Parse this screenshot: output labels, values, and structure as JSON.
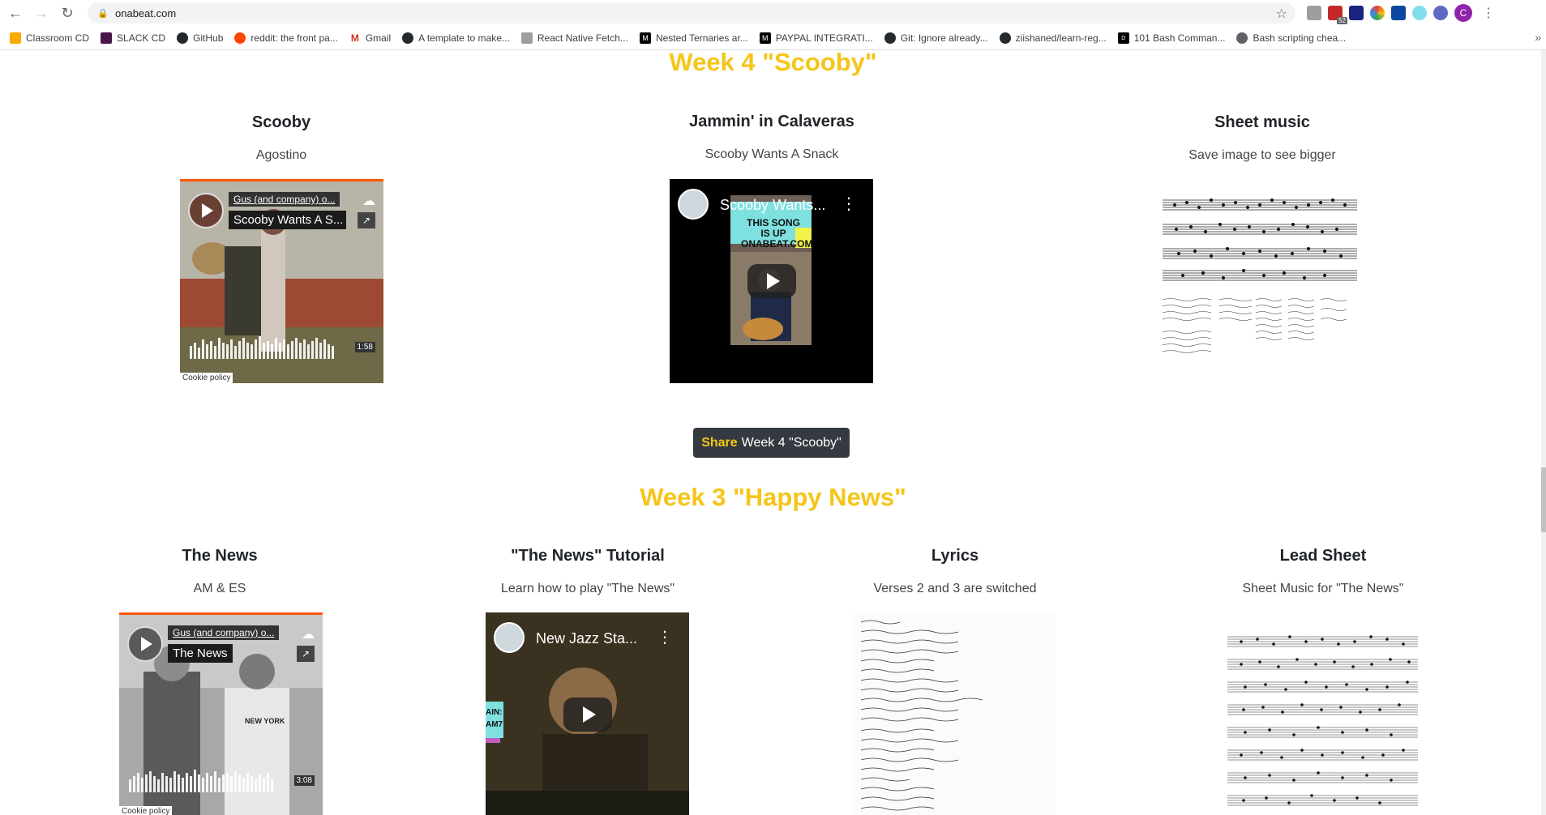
{
  "browser": {
    "url": "onabeat.com",
    "extension_badge": "52",
    "profile_initial": "C",
    "bookmarks": [
      {
        "label": "Classroom CD",
        "color": "#f9ab00"
      },
      {
        "label": "SLACK CD",
        "color": "#4a154b"
      },
      {
        "label": "GitHub",
        "color": "#24292e"
      },
      {
        "label": "reddit: the front pa...",
        "color": "#ff4500"
      },
      {
        "label": "Gmail",
        "color": "#d93025"
      },
      {
        "label": "A template to make...",
        "color": "#24292e"
      },
      {
        "label": "React Native Fetch...",
        "color": "#9e9e9e"
      },
      {
        "label": "Nested Ternaries ar...",
        "color": "#000000"
      },
      {
        "label": "PAYPAL INTEGRATI...",
        "color": "#000000"
      },
      {
        "label": "Git: Ignore already...",
        "color": "#24292e"
      },
      {
        "label": "ziishaned/learn-reg...",
        "color": "#24292e"
      },
      {
        "label": "101 Bash Comman...",
        "color": "#000000"
      },
      {
        "label": "Bash scripting chea...",
        "color": "#5f6368"
      }
    ]
  },
  "week4": {
    "title": "Week 4 \"Scooby\"",
    "cards": [
      {
        "title": "Scooby",
        "subtitle": "Agostino"
      },
      {
        "title": "Jammin' in Calaveras",
        "subtitle": "Scooby Wants A Snack"
      },
      {
        "title": "Sheet music",
        "subtitle": "Save image to see bigger"
      }
    ],
    "soundcloud": {
      "artist": "Gus (and company) o...",
      "track": "Scooby Wants A S...",
      "time": "1:58",
      "cookie": "Cookie policy"
    },
    "youtube": {
      "title": "Scooby Wants..."
    },
    "share_word": "Share",
    "share_target": "Week 4 \"Scooby\""
  },
  "week3": {
    "title": "Week 3 \"Happy News\"",
    "cards": [
      {
        "title": "The News",
        "subtitle": "AM & ES"
      },
      {
        "title": "\"The News\" Tutorial",
        "subtitle": "Learn how to play \"The News\""
      },
      {
        "title": "Lyrics",
        "subtitle": "Verses 2 and 3 are switched"
      },
      {
        "title": "Lead Sheet",
        "subtitle": "Sheet Music for \"The News\""
      }
    ],
    "soundcloud": {
      "artist": "Gus (and company) o...",
      "track": "The News",
      "time": "3:08",
      "cookie": "Cookie policy"
    },
    "youtube": {
      "title": "New Jazz Sta..."
    }
  },
  "colors": {
    "accent": "#f5c518",
    "button_bg": "#343a40",
    "soundcloud_orange": "#ff5500"
  }
}
